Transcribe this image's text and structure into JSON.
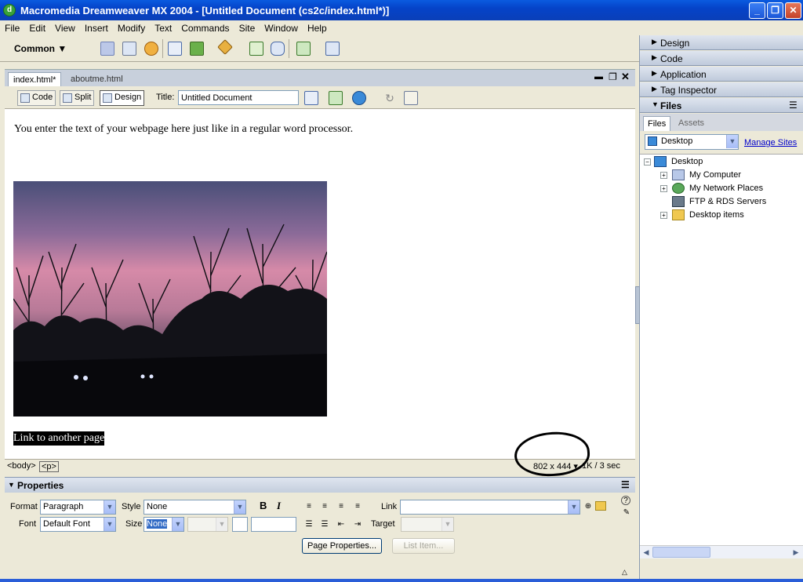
{
  "window": {
    "title": "Macromedia Dreamweaver MX 2004 - [Untitled Document (cs2c/index.html*)]"
  },
  "menu": [
    "File",
    "Edit",
    "View",
    "Insert",
    "Modify",
    "Text",
    "Commands",
    "Site",
    "Window",
    "Help"
  ],
  "insert_bar": {
    "category": "Common"
  },
  "doc_tabs": [
    "index.html*",
    "aboutme.html"
  ],
  "doc_toolbar": {
    "code_label": "Code",
    "split_label": "Split",
    "design_label": "Design",
    "title_label": "Title:",
    "title_value": "Untitled Document"
  },
  "design_view": {
    "body_text": "You enter the text of your webpage here just like in a regular word processor.",
    "link_text": "Link to another page"
  },
  "status_bar": {
    "tag_body": "<body>",
    "tag_p": "<p>",
    "window_size": "802 x 444",
    "download": "1K / 3 sec"
  },
  "properties": {
    "header": "Properties",
    "format_label": "Format",
    "format_value": "Paragraph",
    "style_label": "Style",
    "style_value": "None",
    "link_label": "Link",
    "font_label": "Font",
    "font_value": "Default Font",
    "size_label": "Size",
    "size_value": "None",
    "target_label": "Target",
    "bold": "B",
    "italic": "I",
    "page_properties_label": "Page Properties...",
    "list_item_label": "List Item..."
  },
  "right_panel": {
    "groups": [
      "Design",
      "Code",
      "Application",
      "Tag Inspector",
      "Files"
    ],
    "files_tab": "Files",
    "assets_tab": "Assets",
    "site_value": "Desktop",
    "manage_sites": "Manage Sites",
    "tree": [
      "Desktop",
      "My Computer",
      "My Network Places",
      "FTP & RDS Servers",
      "Desktop items"
    ]
  },
  "colors": {
    "titlebar": "#0a4fd6",
    "panel_header": "#c4cedd",
    "link_highlight": "#000000"
  }
}
